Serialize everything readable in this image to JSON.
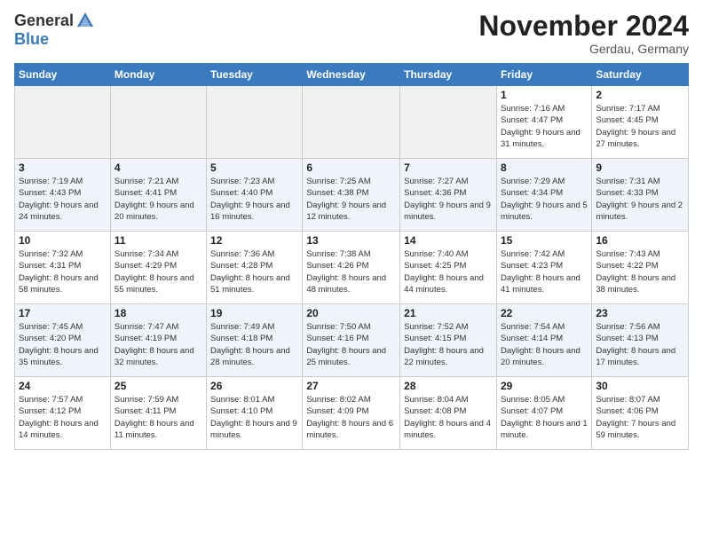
{
  "logo": {
    "general": "General",
    "blue": "Blue"
  },
  "title": "November 2024",
  "location": "Gerdau, Germany",
  "weekdays": [
    "Sunday",
    "Monday",
    "Tuesday",
    "Wednesday",
    "Thursday",
    "Friday",
    "Saturday"
  ],
  "weeks": [
    [
      {
        "day": "",
        "empty": true
      },
      {
        "day": "",
        "empty": true
      },
      {
        "day": "",
        "empty": true
      },
      {
        "day": "",
        "empty": true
      },
      {
        "day": "",
        "empty": true
      },
      {
        "day": "1",
        "sunrise": "Sunrise: 7:16 AM",
        "sunset": "Sunset: 4:47 PM",
        "daylight": "Daylight: 9 hours and 31 minutes."
      },
      {
        "day": "2",
        "sunrise": "Sunrise: 7:17 AM",
        "sunset": "Sunset: 4:45 PM",
        "daylight": "Daylight: 9 hours and 27 minutes."
      }
    ],
    [
      {
        "day": "3",
        "sunrise": "Sunrise: 7:19 AM",
        "sunset": "Sunset: 4:43 PM",
        "daylight": "Daylight: 9 hours and 24 minutes."
      },
      {
        "day": "4",
        "sunrise": "Sunrise: 7:21 AM",
        "sunset": "Sunset: 4:41 PM",
        "daylight": "Daylight: 9 hours and 20 minutes."
      },
      {
        "day": "5",
        "sunrise": "Sunrise: 7:23 AM",
        "sunset": "Sunset: 4:40 PM",
        "daylight": "Daylight: 9 hours and 16 minutes."
      },
      {
        "day": "6",
        "sunrise": "Sunrise: 7:25 AM",
        "sunset": "Sunset: 4:38 PM",
        "daylight": "Daylight: 9 hours and 12 minutes."
      },
      {
        "day": "7",
        "sunrise": "Sunrise: 7:27 AM",
        "sunset": "Sunset: 4:36 PM",
        "daylight": "Daylight: 9 hours and 9 minutes."
      },
      {
        "day": "8",
        "sunrise": "Sunrise: 7:29 AM",
        "sunset": "Sunset: 4:34 PM",
        "daylight": "Daylight: 9 hours and 5 minutes."
      },
      {
        "day": "9",
        "sunrise": "Sunrise: 7:31 AM",
        "sunset": "Sunset: 4:33 PM",
        "daylight": "Daylight: 9 hours and 2 minutes."
      }
    ],
    [
      {
        "day": "10",
        "sunrise": "Sunrise: 7:32 AM",
        "sunset": "Sunset: 4:31 PM",
        "daylight": "Daylight: 8 hours and 58 minutes."
      },
      {
        "day": "11",
        "sunrise": "Sunrise: 7:34 AM",
        "sunset": "Sunset: 4:29 PM",
        "daylight": "Daylight: 8 hours and 55 minutes."
      },
      {
        "day": "12",
        "sunrise": "Sunrise: 7:36 AM",
        "sunset": "Sunset: 4:28 PM",
        "daylight": "Daylight: 8 hours and 51 minutes."
      },
      {
        "day": "13",
        "sunrise": "Sunrise: 7:38 AM",
        "sunset": "Sunset: 4:26 PM",
        "daylight": "Daylight: 8 hours and 48 minutes."
      },
      {
        "day": "14",
        "sunrise": "Sunrise: 7:40 AM",
        "sunset": "Sunset: 4:25 PM",
        "daylight": "Daylight: 8 hours and 44 minutes."
      },
      {
        "day": "15",
        "sunrise": "Sunrise: 7:42 AM",
        "sunset": "Sunset: 4:23 PM",
        "daylight": "Daylight: 8 hours and 41 minutes."
      },
      {
        "day": "16",
        "sunrise": "Sunrise: 7:43 AM",
        "sunset": "Sunset: 4:22 PM",
        "daylight": "Daylight: 8 hours and 38 minutes."
      }
    ],
    [
      {
        "day": "17",
        "sunrise": "Sunrise: 7:45 AM",
        "sunset": "Sunset: 4:20 PM",
        "daylight": "Daylight: 8 hours and 35 minutes."
      },
      {
        "day": "18",
        "sunrise": "Sunrise: 7:47 AM",
        "sunset": "Sunset: 4:19 PM",
        "daylight": "Daylight: 8 hours and 32 minutes."
      },
      {
        "day": "19",
        "sunrise": "Sunrise: 7:49 AM",
        "sunset": "Sunset: 4:18 PM",
        "daylight": "Daylight: 8 hours and 28 minutes."
      },
      {
        "day": "20",
        "sunrise": "Sunrise: 7:50 AM",
        "sunset": "Sunset: 4:16 PM",
        "daylight": "Daylight: 8 hours and 25 minutes."
      },
      {
        "day": "21",
        "sunrise": "Sunrise: 7:52 AM",
        "sunset": "Sunset: 4:15 PM",
        "daylight": "Daylight: 8 hours and 22 minutes."
      },
      {
        "day": "22",
        "sunrise": "Sunrise: 7:54 AM",
        "sunset": "Sunset: 4:14 PM",
        "daylight": "Daylight: 8 hours and 20 minutes."
      },
      {
        "day": "23",
        "sunrise": "Sunrise: 7:56 AM",
        "sunset": "Sunset: 4:13 PM",
        "daylight": "Daylight: 8 hours and 17 minutes."
      }
    ],
    [
      {
        "day": "24",
        "sunrise": "Sunrise: 7:57 AM",
        "sunset": "Sunset: 4:12 PM",
        "daylight": "Daylight: 8 hours and 14 minutes."
      },
      {
        "day": "25",
        "sunrise": "Sunrise: 7:59 AM",
        "sunset": "Sunset: 4:11 PM",
        "daylight": "Daylight: 8 hours and 11 minutes."
      },
      {
        "day": "26",
        "sunrise": "Sunrise: 8:01 AM",
        "sunset": "Sunset: 4:10 PM",
        "daylight": "Daylight: 8 hours and 9 minutes."
      },
      {
        "day": "27",
        "sunrise": "Sunrise: 8:02 AM",
        "sunset": "Sunset: 4:09 PM",
        "daylight": "Daylight: 8 hours and 6 minutes."
      },
      {
        "day": "28",
        "sunrise": "Sunrise: 8:04 AM",
        "sunset": "Sunset: 4:08 PM",
        "daylight": "Daylight: 8 hours and 4 minutes."
      },
      {
        "day": "29",
        "sunrise": "Sunrise: 8:05 AM",
        "sunset": "Sunset: 4:07 PM",
        "daylight": "Daylight: 8 hours and 1 minute."
      },
      {
        "day": "30",
        "sunrise": "Sunrise: 8:07 AM",
        "sunset": "Sunset: 4:06 PM",
        "daylight": "Daylight: 7 hours and 59 minutes."
      }
    ]
  ]
}
